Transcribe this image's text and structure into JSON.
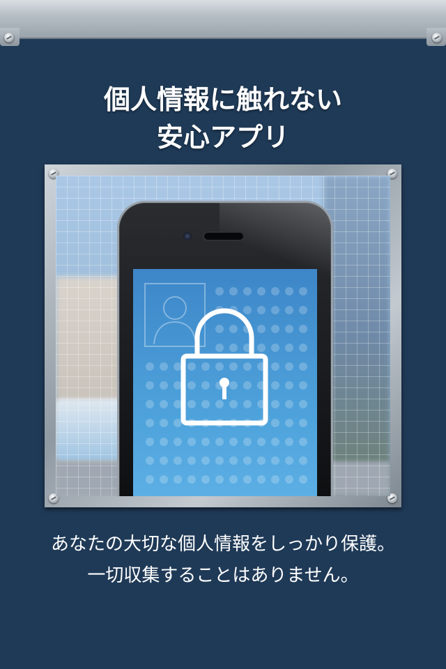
{
  "heading": {
    "line1": "個人情報に触れない",
    "line2": "安心アプリ"
  },
  "illustration": {
    "icons": [
      "lock-icon",
      "person-silhouette-icon"
    ]
  },
  "description": {
    "line1": "あなたの大切な個人情報をしっかり保護。",
    "line2": "一切収集することはありません。"
  },
  "colors": {
    "background": "#1f3a57",
    "text": "#ffffff",
    "screen": "#4ea2db"
  }
}
